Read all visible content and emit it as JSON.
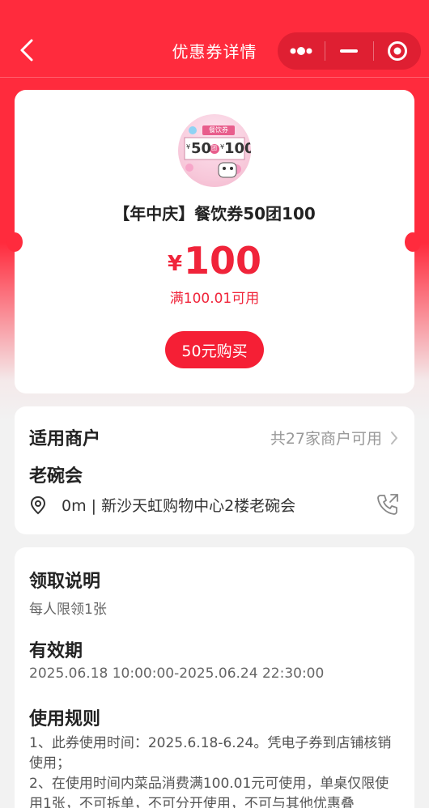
{
  "nav": {
    "title": "优惠券详情"
  },
  "coupon": {
    "title": "【年中庆】餐饮券50团100",
    "currency": "¥",
    "amount": "100",
    "condition": "满100.01可用",
    "buy_label": "50元购买",
    "thumb": {
      "tag": "餐饮券",
      "price_a": "50",
      "mid": "团",
      "price_b": "100",
      "yen": "¥"
    }
  },
  "merchant": {
    "section_title": "适用商户",
    "count_text": "共27家商户可用",
    "name": "老碗会",
    "address": "0m | 新沙天虹购物中心2楼老碗会"
  },
  "details": {
    "claim_title": "领取说明",
    "claim_text": "每人限领1张",
    "validity_title": "有效期",
    "validity_text": "2025.06.18 10:00:00-2025.06.24 22:30:00",
    "rules_title": "使用规则",
    "rules": [
      "1、此券使用时间：2025.6.18-6.24。凭电子券到店铺核销使用；",
      "2、在使用时间内菜品消费满100.01元可使用，单桌仅限使用1张，不可拆单，不可分开使用，不可与其他优惠叠"
    ]
  },
  "colors": {
    "brand_red": "#ff2b3d",
    "price_red": "#f0243a"
  }
}
